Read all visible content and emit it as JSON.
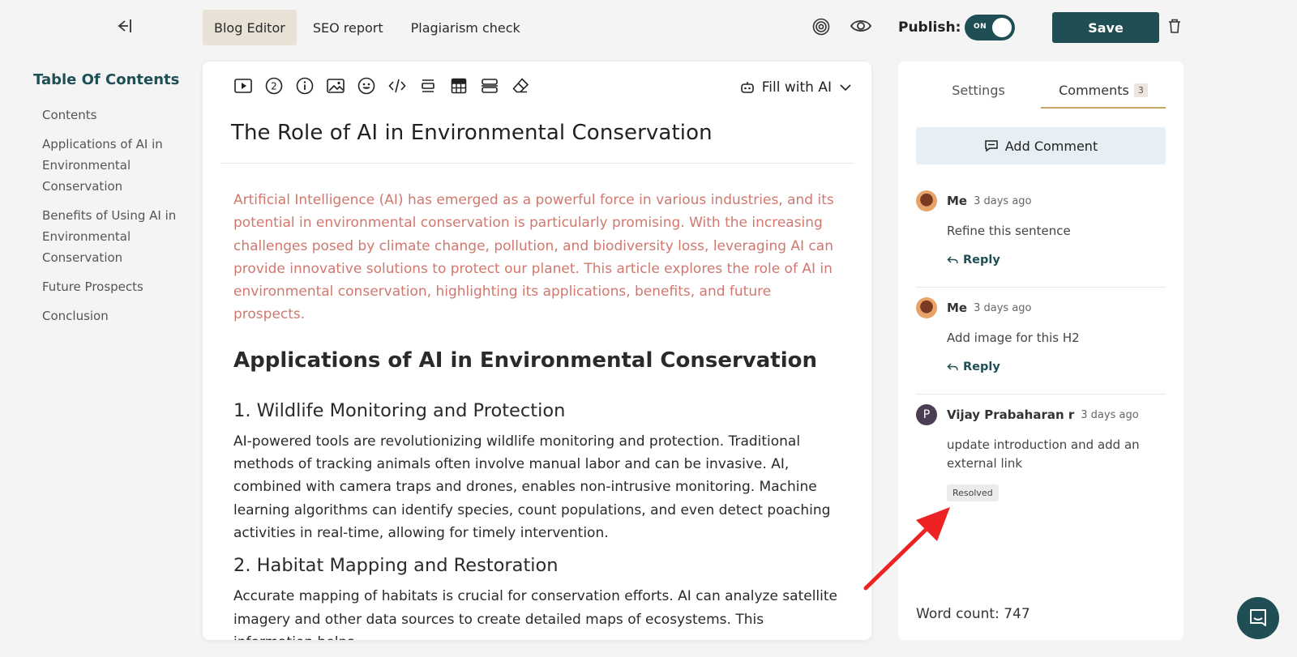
{
  "header": {
    "tabs": [
      {
        "label": "Blog Editor",
        "active": true
      },
      {
        "label": "SEO report",
        "active": false
      },
      {
        "label": "Plagiarism check",
        "active": false
      }
    ],
    "publish_label": "Publish:",
    "toggle_label": "ON",
    "save_label": "Save",
    "icons": [
      "target-icon",
      "eye-icon",
      "trash-icon",
      "back-arrow-icon"
    ]
  },
  "toc": {
    "title": "Table Of Contents",
    "items": [
      "Contents",
      "Applications of AI in Environmental Conservation",
      "Benefits of Using AI in Environmental Conservation",
      "Future Prospects",
      "Conclusion"
    ]
  },
  "editor": {
    "toolbar_icons": [
      "video-icon",
      "number-icon",
      "info-icon",
      "image-icon",
      "emoji-icon",
      "code-icon",
      "divider-icon",
      "table-icon",
      "layout-icon",
      "eraser-icon"
    ],
    "fill_ai_label": "Fill with AI",
    "title": "The Role of AI in Environmental Conservation",
    "intro": "Artificial Intelligence (AI) has emerged as a powerful force in various industries, and its potential in environmental conservation is particularly promising. With the increasing challenges posed by climate change, pollution, and biodiversity loss, leveraging AI can provide innovative solutions to protect our planet. This article explores the role of AI in environmental conservation, highlighting its applications, benefits, and future prospects.",
    "h2": "Applications of AI in Environmental Conservation",
    "sections": [
      {
        "heading": "1. Wildlife Monitoring and Protection",
        "body": "AI-powered tools are revolutionizing wildlife monitoring and protection. Traditional methods of tracking animals often involve manual labor and can be invasive. AI, combined with camera traps and drones, enables non-intrusive monitoring. Machine learning algorithms can identify species, count populations, and even detect poaching activities in real-time, allowing for timely intervention."
      },
      {
        "heading": "2. Habitat Mapping and Restoration",
        "body": "Accurate mapping of habitats is crucial for conservation efforts. AI can analyze satellite imagery and other data sources to create detailed maps of ecosystems. This information helps"
      }
    ]
  },
  "panel": {
    "tabs": [
      {
        "label": "Settings",
        "active": false
      },
      {
        "label": "Comments",
        "active": true,
        "count": "3"
      }
    ],
    "add_comment_label": "Add Comment",
    "comments": [
      {
        "author": "Me",
        "time": "3 days ago",
        "text": "Refine this sentence",
        "reply": "Reply"
      },
      {
        "author": "Me",
        "time": "3 days ago",
        "text": "Add image for this H2",
        "reply": "Reply"
      },
      {
        "author": "Vijay Prabaharan r",
        "avatar_letter": "P",
        "time": "3 days ago",
        "text": "update introduction and add an external link",
        "status": "Resolved"
      }
    ],
    "word_count": "Word count: 747"
  },
  "colors": {
    "brand": "#1f4f55",
    "intro_text": "#d1786e",
    "active_tab_bg": "#e8e2d6",
    "annotation_arrow": "#ee2222"
  }
}
